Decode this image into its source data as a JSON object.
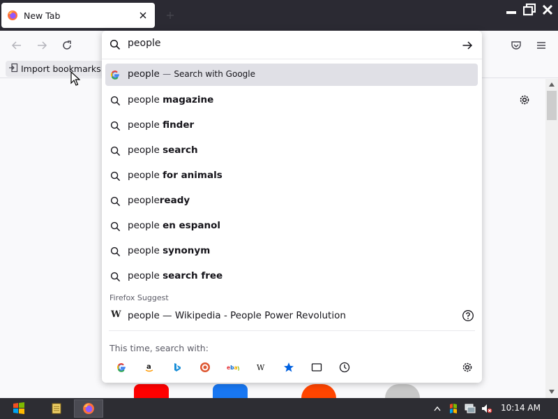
{
  "tab": {
    "title": "New Tab",
    "close_icon": "close-icon",
    "favicon": "firefox-icon"
  },
  "window_controls": [
    "minimize-icon",
    "restore-icon",
    "close-icon"
  ],
  "toolbar": {
    "back_icon": "back-arrow-icon",
    "forward_icon": "forward-arrow-icon",
    "reload_icon": "reload-icon",
    "pocket_icon": "pocket-icon",
    "menu_icon": "hamburger-menu-icon"
  },
  "bookmarks": {
    "import_label": "Import bookmarks..."
  },
  "urlbar": {
    "value": "people"
  },
  "suggestions": {
    "google": {
      "query": "people",
      "separator": "—",
      "action": "Search with Google"
    },
    "items": [
      {
        "prefix": "people ",
        "bold": "magazine"
      },
      {
        "prefix": "people ",
        "bold": "finder"
      },
      {
        "prefix": "people ",
        "bold": "search"
      },
      {
        "prefix": "people ",
        "bold": "for animals"
      },
      {
        "prefix": "people",
        "bold": "ready"
      },
      {
        "prefix": "people ",
        "bold": "en espanol"
      },
      {
        "prefix": "people ",
        "bold": "synonym"
      },
      {
        "prefix": "people ",
        "bold": "search free"
      }
    ]
  },
  "firefox_suggest": {
    "label": "Firefox Suggest",
    "wiki_text": "people — Wikipedia - People Power Revolution",
    "wiki_icon": "W"
  },
  "one_off": {
    "label": "This time, search with:",
    "engines": [
      "google-icon",
      "amazon-icon",
      "bing-icon",
      "duckduckgo-icon",
      "ebay-icon",
      "wikipedia-icon",
      "bookmarks-star-icon",
      "tabs-icon",
      "history-icon"
    ]
  },
  "taskbar": {
    "time": "10:14 AM"
  },
  "colors": {
    "tabbar": "#2b2a33",
    "selected_row": "#e0e0e6",
    "taskbar": "#2d2d33"
  }
}
